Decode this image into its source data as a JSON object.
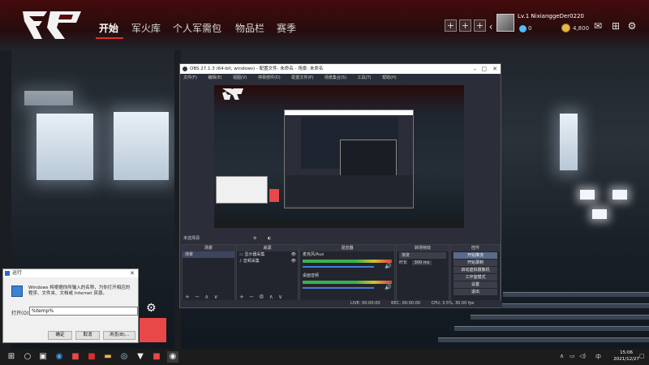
{
  "game": {
    "nav": [
      "开始",
      "军火库",
      "个人军需包",
      "物品栏",
      "赛季"
    ],
    "player": {
      "level_name": "Lv.1  NixianggeDer0220",
      "currency_a": "0",
      "coins": "4,800"
    },
    "icons": [
      "plus-icon",
      "plus-icon",
      "plus-icon",
      "back-icon",
      "mail-icon",
      "grid-icon",
      "gear-icon"
    ]
  },
  "obs": {
    "title": "OBS 27.1.3 (64-bit, windows) - 配置文件: 未命名 - 场景: 未命名",
    "menu": [
      "文件(F)",
      "编辑(E)",
      "视图(V)",
      "停靠部件(D)",
      "配置文件(P)",
      "场景集合(S)",
      "工具(T)",
      "帮助(H)"
    ],
    "scene_label": "未选择源",
    "docks": {
      "scenes": {
        "title": "场景",
        "items": [
          "场景"
        ]
      },
      "sources": {
        "title": "来源",
        "items": [
          "显示器采集",
          "音频采集"
        ]
      },
      "mixer": {
        "title": "混音器",
        "channels": [
          "麦克风/Aux",
          "桌面音频"
        ]
      },
      "transitions": {
        "title": "转场特效",
        "type": "渐变",
        "duration_label": "时长",
        "duration_value": "300 ms"
      },
      "controls": {
        "title": "控件",
        "buttons": [
          "开始推流",
          "开始录制",
          "启动虚拟摄像机",
          "工作室模式",
          "设置",
          "退出"
        ]
      }
    },
    "status": {
      "live": "LIVE: 00:00:00",
      "rec": "REC: 00:00:00",
      "cpu": "CPU: 3.5%, 30.00 fps"
    }
  },
  "run_dialog": {
    "title": "运行",
    "description": "Windows 将根据你所输入的名称，为你打开相应的程序、文件夹、文档或 Internet 资源。",
    "open_label": "打开(O):",
    "input_value": "%temp%",
    "ok": "确定",
    "cancel": "取消",
    "browse": "浏览(B)..."
  },
  "taskbar": {
    "time": "15:06",
    "date": "2021/12/27",
    "lang": "中"
  },
  "colors": {
    "accent_red": "#e03030",
    "coin": "#e8b84a"
  }
}
